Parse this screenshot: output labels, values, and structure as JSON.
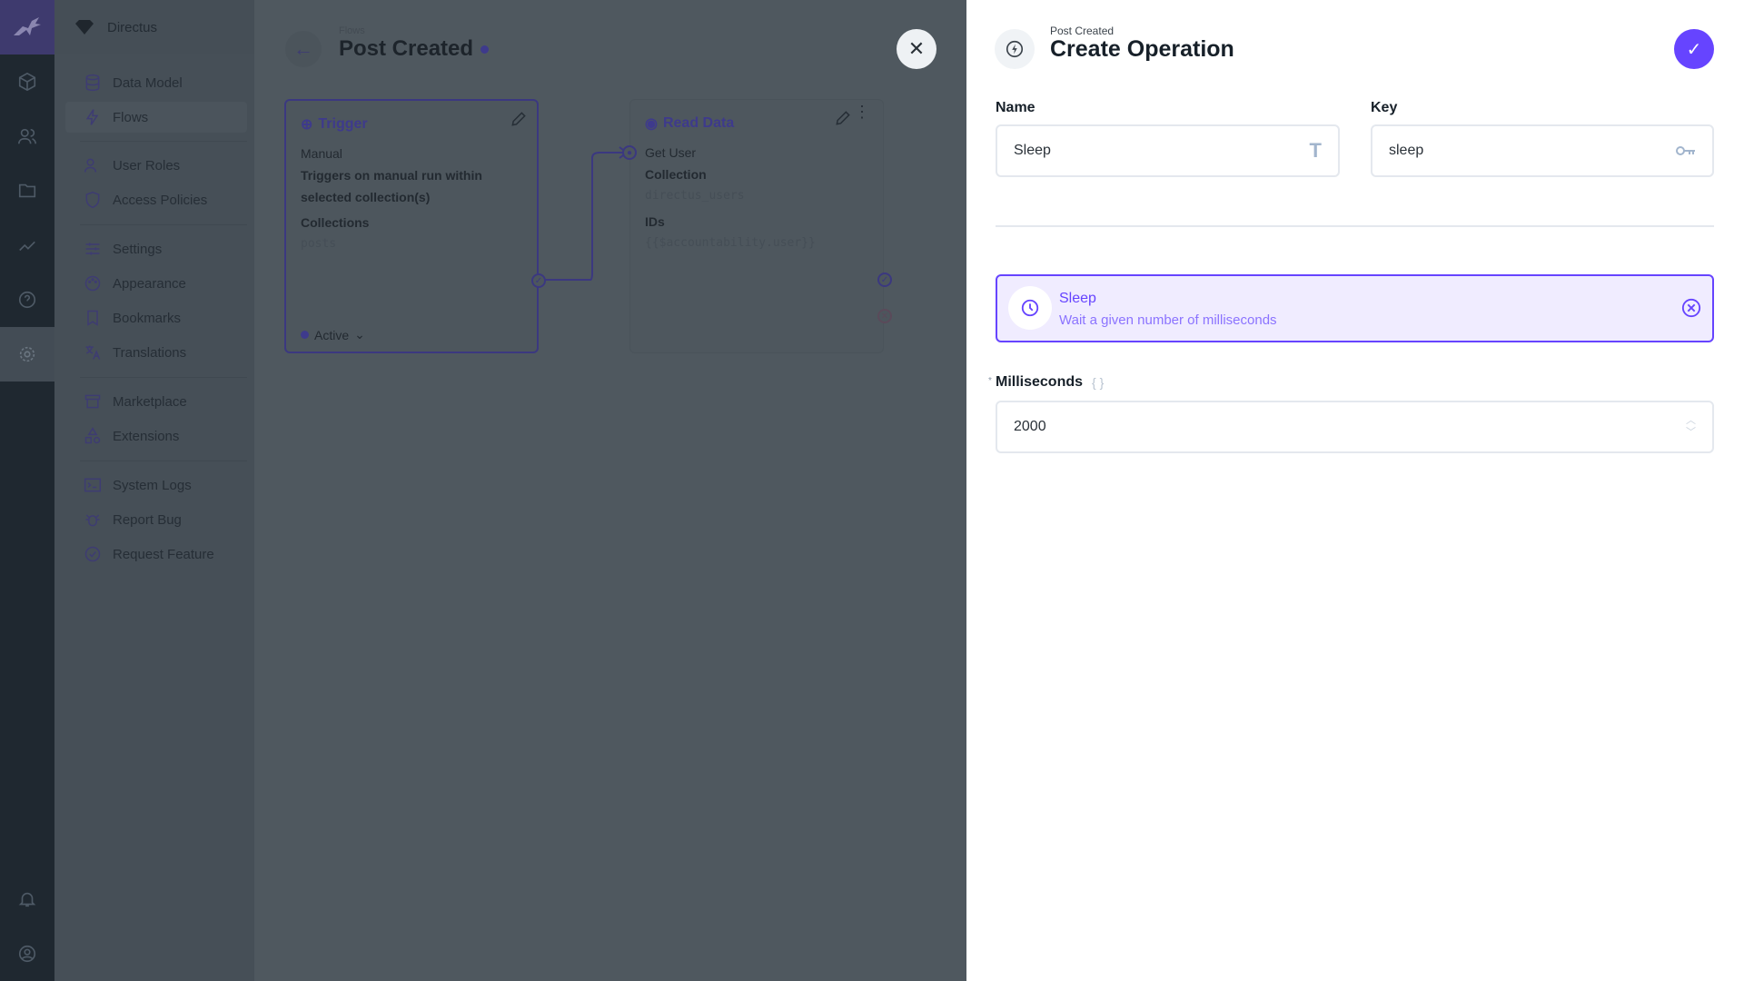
{
  "nav": {
    "project": "Directus",
    "items": [
      "Data Model",
      "Flows",
      "User Roles",
      "Access Policies",
      "Settings",
      "Appearance",
      "Bookmarks",
      "Translations",
      "Marketplace",
      "Extensions",
      "System Logs",
      "Report Bug",
      "Request Feature"
    ]
  },
  "header": {
    "breadcrumb": "Flows",
    "title": "Post Created"
  },
  "trigger": {
    "title": "Trigger",
    "type": "Manual",
    "description_1": "Triggers on manual run within",
    "description_2": "selected collection(s)",
    "collections_label": "Collections",
    "collections_value": "posts",
    "status": "Active"
  },
  "read": {
    "title": "Read Data",
    "name": "Get User",
    "collection_label": "Collection",
    "collection_value": "directus_users",
    "ids_label": "IDs",
    "ids_value": "{{$accountability.user}}"
  },
  "panel": {
    "breadcrumb": "Post Created",
    "title": "Create Operation",
    "name_label": "Name",
    "name_value": "Sleep",
    "key_label": "Key",
    "key_value": "sleep",
    "operation_title": "Sleep",
    "operation_desc": "Wait a given number of milliseconds",
    "ms_label": "Milliseconds",
    "ms_required": "*",
    "ms_value": "2000"
  },
  "colors": {
    "accent": "#6644ff",
    "accent_bg": "#f0ecff"
  }
}
